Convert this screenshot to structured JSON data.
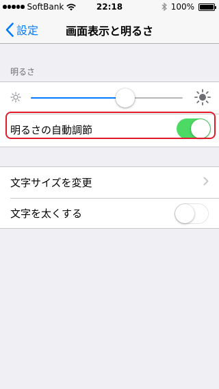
{
  "status_bar": {
    "carrier": "SoftBank",
    "time": "22:18",
    "battery": "100%",
    "signal_bars": 5
  },
  "nav": {
    "back_label": "設定",
    "title": "画面表示と明るさ"
  },
  "brightness_section": {
    "header": "明るさ",
    "slider_value": 0.62,
    "auto_brightness_label": "明るさの自動調節",
    "auto_brightness_on": true
  },
  "text_section": {
    "text_size_label": "文字サイズを変更",
    "bold_text_label": "文字を太くする",
    "bold_text_on": false
  },
  "colors": {
    "accent": "#007aff",
    "toggle_on": "#4cd964",
    "highlight": "#e0192b",
    "background": "#efeff4"
  }
}
